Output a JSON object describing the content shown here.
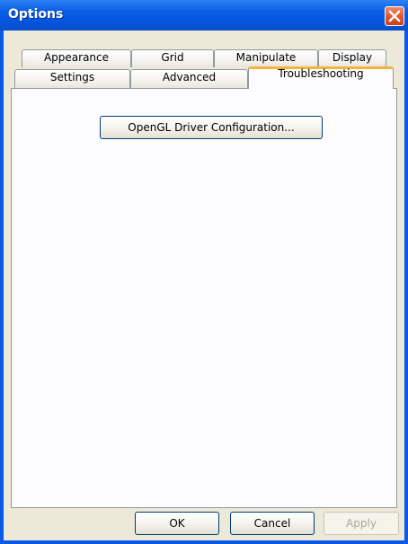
{
  "window": {
    "title": "Options"
  },
  "tabs": {
    "row_back": [
      {
        "label": "Appearance"
      },
      {
        "label": "Grid"
      },
      {
        "label": "Manipulate"
      },
      {
        "label": "Display"
      }
    ],
    "row_front": [
      {
        "label": "Settings"
      },
      {
        "label": "Advanced"
      },
      {
        "label": "Troubleshooting",
        "active": true
      }
    ]
  },
  "troubleshooting": {
    "opengl_button_label": "OpenGL Driver Configuration..."
  },
  "footer": {
    "ok_label": "OK",
    "cancel_label": "Cancel",
    "apply_label": "Apply"
  },
  "icons": {
    "close": "close-icon"
  },
  "colors": {
    "titlebar": "#0555e0",
    "client_bg": "#ece9d8",
    "active_tab_accent": "#f4b63a",
    "close_button": "#e15a2d"
  }
}
